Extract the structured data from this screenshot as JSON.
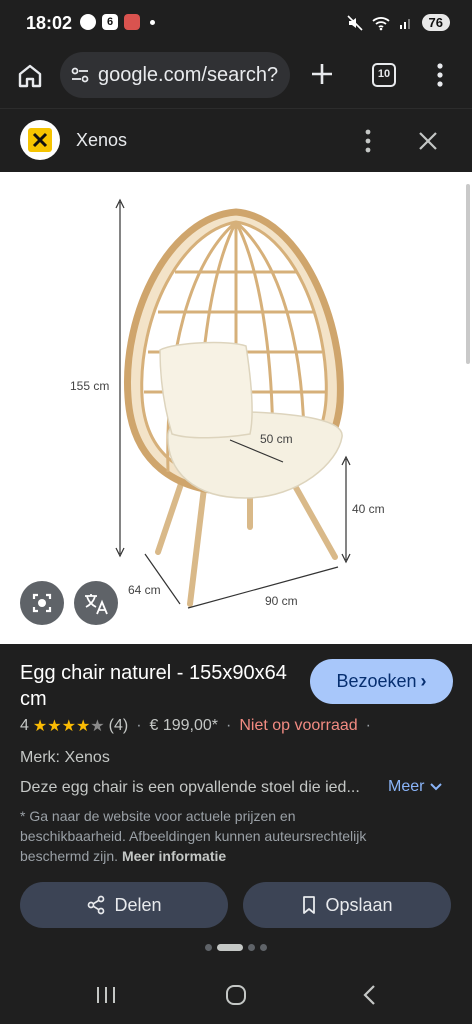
{
  "status": {
    "time": "18:02",
    "notification_badge": "6",
    "battery": "76"
  },
  "browser": {
    "url": "google.com/search?",
    "tab_count": "10"
  },
  "panel": {
    "brand_name": "Xenos"
  },
  "image": {
    "dim_height": "155 cm",
    "dim_seat_width": "50 cm",
    "dim_seat_height": "40 cm",
    "dim_depth": "64 cm",
    "dim_width": "90 cm"
  },
  "product": {
    "title": "Egg chair naturel - 155x90x64 cm",
    "visit_label": "Bezoeken",
    "rating_value": "4",
    "rating_stars": 4,
    "rating_count": "(4)",
    "price": "€ 199,00*",
    "stock": "Niet op voorraad",
    "brand": "Merk: Xenos",
    "description": "Deze egg chair is een opvallende stoel die ied...",
    "more_label": "Meer",
    "disclaimer": "* Ga naar de website voor actuele prijzen en beschikbaarheid. Afbeeldingen kunnen auteursrechtelijk beschermd zijn.",
    "more_info_label": "Meer informatie",
    "share_label": "Delen",
    "save_label": "Opslaan"
  },
  "colors": {
    "accent_button": "#a8c7fa",
    "stock_red": "#f28b82",
    "star_yellow": "#fbbc04",
    "link_blue": "#8ab4f8"
  }
}
